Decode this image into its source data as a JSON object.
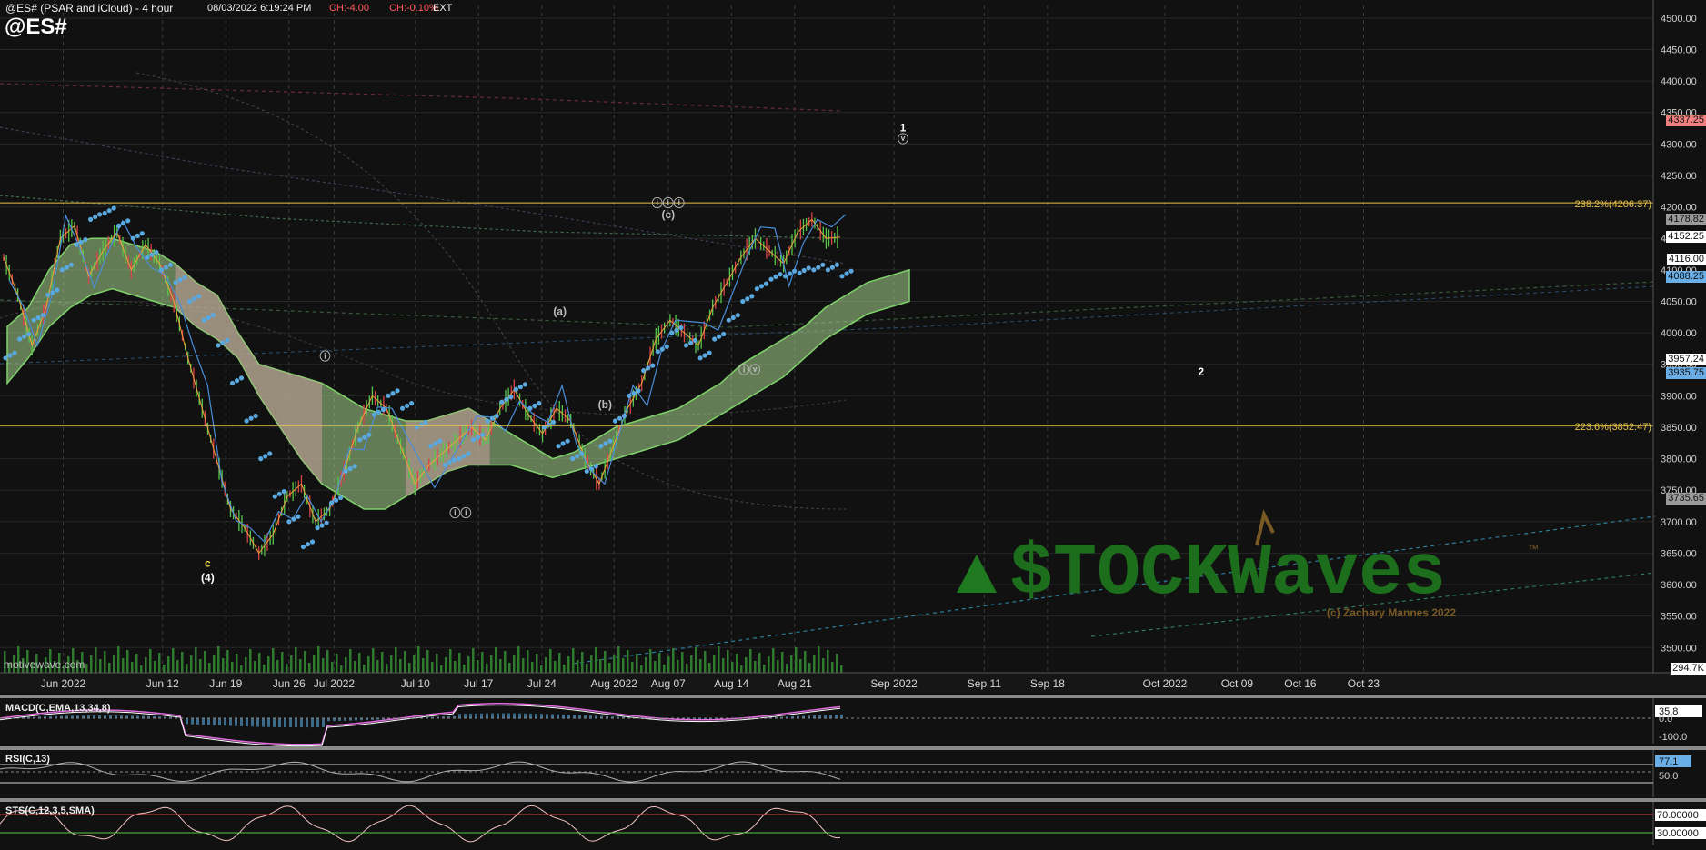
{
  "header": {
    "title": "@ES# (PSAR and iCloud) - 4 hour",
    "datetime": "08/03/2022 6:19:24 PM",
    "change_abs": "CH:-4.00",
    "change_pct": "CH:-0.10%",
    "session": "EXT",
    "symbol": "@ES#"
  },
  "watermark": {
    "brand_text": "$TOCKWaves",
    "trademark": "™",
    "copyright": "(c) Zachary Mannes 2022",
    "motivewave": "motivewave.com"
  },
  "colors": {
    "background": "#111111",
    "fib_line": "#e8c14a",
    "psar": "#5aa8e0",
    "cloud_bull": "#a7d58f",
    "cloud_bear": "#c79a9a",
    "price_up": "#59c54b",
    "price_down": "#d94444",
    "macd": "#e26be0",
    "rsi_line": "#b0b0b0",
    "stoch_k": "#f0c0c0"
  },
  "chart_data": [
    {
      "type": "line",
      "panel": "price",
      "title": "@ES# (PSAR and iCloud) - 4 hour",
      "ylim": [
        3460,
        4520
      ],
      "y_ticks": [
        3500,
        3550,
        3600,
        3650,
        3700,
        3750,
        3800,
        3850,
        3900,
        3950,
        4000,
        4050,
        4100,
        4150,
        4200,
        4250,
        4300,
        4350,
        4400,
        4450,
        4500
      ],
      "x_ticks": [
        "Jun 2022",
        "Jun 12",
        "Jun 19",
        "Jun 26",
        "Jul 2022",
        "Jul 10",
        "Jul 17",
        "Jul 24",
        "Aug 2022",
        "Aug 07",
        "Aug 14",
        "Aug 21",
        "Sep 2022",
        "Sep 11",
        "Sep 18",
        "Oct 2022",
        "Oct 09",
        "Oct 16",
        "Oct 23"
      ],
      "grid": true,
      "price_path": [
        4120,
        4060,
        3980,
        4040,
        4150,
        4170,
        4090,
        4130,
        4160,
        4100,
        4140,
        4110,
        4050,
        3960,
        3880,
        3800,
        3720,
        3690,
        3650,
        3680,
        3740,
        3760,
        3700,
        3720,
        3780,
        3850,
        3900,
        3880,
        3820,
        3760,
        3790,
        3810,
        3830,
        3850,
        3830,
        3880,
        3910,
        3870,
        3840,
        3880,
        3860,
        3800,
        3760,
        3820,
        3880,
        3920,
        3990,
        4020,
        4000,
        3980,
        4040,
        4080,
        4120,
        4150,
        4130,
        4110,
        4160,
        4180,
        4150,
        4152
      ],
      "psar_path": [
        3960,
        3990,
        4020,
        4060,
        4100,
        4140,
        4180,
        4190,
        4170,
        4150,
        4120,
        4100,
        4080,
        4050,
        4020,
        3980,
        3920,
        3860,
        3800,
        3740,
        3700,
        3660,
        3690,
        3730,
        3780,
        3830,
        3870,
        3900,
        3880,
        3850,
        3820,
        3790,
        3800,
        3830,
        3860,
        3890,
        3910,
        3880,
        3850,
        3820,
        3800,
        3780,
        3820,
        3860,
        3900,
        3940,
        3970,
        4000,
        3980,
        3960,
        3990,
        4020,
        4050,
        4070,
        4085,
        4090,
        4095,
        4100,
        4100,
        4090
      ],
      "cloud_upper": [
        4010,
        4040,
        4100,
        4140,
        4150,
        4150,
        4140,
        4130,
        4110,
        4080,
        4060,
        4000,
        3950,
        3940,
        3930,
        3920,
        3900,
        3880,
        3870,
        3860,
        3860,
        3870,
        3880,
        3860,
        3840,
        3820,
        3800,
        3810,
        3830,
        3850,
        3860,
        3870,
        3880,
        3900,
        3920,
        3950,
        3970,
        3990,
        4010,
        4040,
        4060,
        4080,
        4090,
        4100
      ],
      "cloud_lower": [
        3920,
        3960,
        4010,
        4040,
        4060,
        4070,
        4060,
        4050,
        4040,
        4010,
        3990,
        3960,
        3900,
        3850,
        3800,
        3760,
        3740,
        3720,
        3720,
        3740,
        3760,
        3780,
        3790,
        3790,
        3790,
        3780,
        3770,
        3780,
        3790,
        3800,
        3810,
        3820,
        3830,
        3850,
        3870,
        3890,
        3910,
        3930,
        3960,
        3990,
        4010,
        4030,
        4040,
        4050
      ],
      "fib_levels": [
        {
          "label": "238.2%(4206.37)",
          "value": 4206.37
        },
        {
          "label": "223.6%(3852.47)",
          "value": 3852.47
        }
      ],
      "price_tags": [
        {
          "text": "4337.25",
          "value": 4337.25,
          "color": "#f08080"
        },
        {
          "text": "4178.82",
          "value": 4178.82,
          "color": "#9a9a9a"
        },
        {
          "text": "4152.25",
          "value": 4152.25,
          "color": "#ffffff"
        },
        {
          "text": "4116.00",
          "value": 4116.0,
          "color": "#ffffff"
        },
        {
          "text": "4088.25",
          "value": 4088.25,
          "color": "#6aaee8"
        },
        {
          "text": "3957.24",
          "value": 3957.24,
          "color": "#ffffff"
        },
        {
          "text": "3935.75",
          "value": 3935.75,
          "color": "#6aaee8"
        },
        {
          "text": "3735.65",
          "value": 3735.65,
          "color": "#9a9a9a"
        }
      ],
      "volume_tag": "294.7K",
      "wave_labels": [
        {
          "text": "c",
          "x_date": "2022-06-17",
          "value": 3628,
          "color": "#f2e24a"
        },
        {
          "text": "(4)",
          "x_date": "2022-06-17",
          "value": 3605,
          "color": "#ffffff"
        },
        {
          "text": "ⓘ",
          "x_date": "2022-06-30",
          "value": 3957,
          "color": "#bbbbbb"
        },
        {
          "text": "ⓘⓘ",
          "x_date": "2022-07-15",
          "value": 3708,
          "color": "#bbbbbb"
        },
        {
          "text": "(a)",
          "x_date": "2022-07-26",
          "value": 4028,
          "color": "#bbbbbb"
        },
        {
          "text": "(b)",
          "x_date": "2022-07-31",
          "value": 3880,
          "color": "#bbbbbb"
        },
        {
          "text": "ⓘⓘⓘ",
          "x_date": "2022-08-07",
          "value": 4200,
          "color": "#bbbbbb"
        },
        {
          "text": "(c)",
          "x_date": "2022-08-07",
          "value": 4182,
          "color": "#bbbbbb"
        },
        {
          "text": "ⓘⓥ",
          "x_date": "2022-08-16",
          "value": 3935,
          "color": "#bbbbbb"
        },
        {
          "text": "1",
          "x_date": "2022-09-02",
          "value": 4320,
          "color": "#ffffff"
        },
        {
          "text": "ⓥ",
          "x_date": "2022-09-02",
          "value": 4302,
          "color": "#bbbbbb"
        },
        {
          "text": "2",
          "x_date": "2022-10-05",
          "value": 3932,
          "color": "#ffffff"
        }
      ]
    },
    {
      "type": "line",
      "panel": "macd",
      "title": "MACD(C,EMA,13,34,8)",
      "y_ticks": [
        "35.8",
        "0.0",
        "-100.0"
      ]
    },
    {
      "type": "line",
      "panel": "rsi",
      "title": "RSI(C,13)",
      "y_ticks": [
        "77.1",
        "50.0"
      ]
    },
    {
      "type": "line",
      "panel": "stochastic",
      "title": "STS(C,12,3,5,SMA)",
      "y_ticks": [
        "70.00000",
        "30.00000"
      ]
    }
  ]
}
